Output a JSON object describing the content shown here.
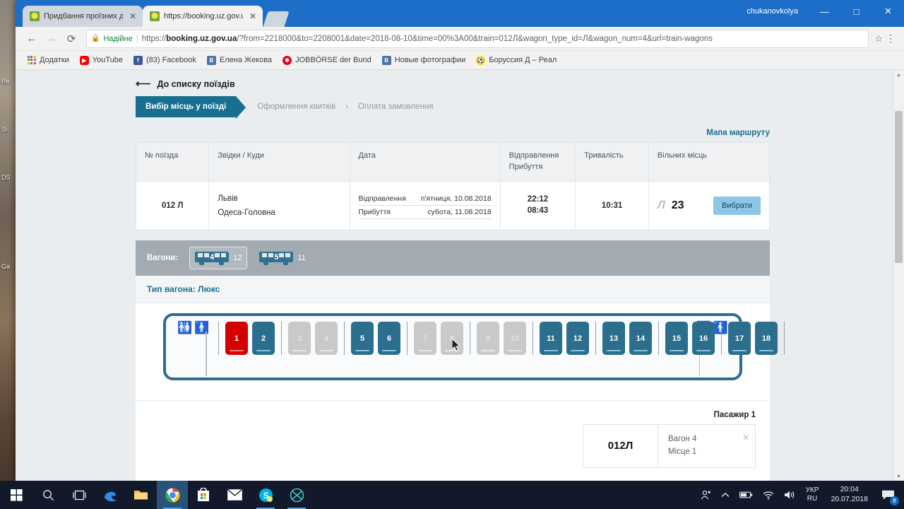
{
  "window": {
    "user": "chukanovkolya",
    "minimize": "—",
    "maximize": "□",
    "close": "✕"
  },
  "tabs": [
    {
      "title": "Придбання проїзних до",
      "close": "✕"
    },
    {
      "title": "https://booking.uz.gov.ua",
      "close": "✕"
    }
  ],
  "toolbar": {
    "back": "←",
    "forward": "→",
    "reload": "⟳",
    "secure_label": "Надійне",
    "url_prefix": "https://",
    "url_host": "booking.uz.gov.ua",
    "url_rest": "/?from=2218000&to=2208001&date=2018-08-10&time=00%3A00&train=012Л&wagon_type_id=Л&wagon_num=4&url=train-wagons",
    "star": "☆",
    "menu": "⋮"
  },
  "bookmarks": [
    {
      "label": "Додатки",
      "icon": "apps-grid-icon"
    },
    {
      "label": "YouTube",
      "icon": "youtube-icon"
    },
    {
      "label": "(83) Facebook",
      "icon": "facebook-icon"
    },
    {
      "label": "Елена Жекова",
      "icon": "vk-icon"
    },
    {
      "label": "JOBBÖRSE der Bund",
      "icon": "arbeitsagentur-icon"
    },
    {
      "label": "Новые фотографии",
      "icon": "vk-icon"
    },
    {
      "label": "Боруссия Д – Реал",
      "icon": "bvb-icon"
    }
  ],
  "page": {
    "back_link": "До списку поїздів",
    "back_arrow": "⟵",
    "steps": [
      {
        "label": "Вибір місць у поїзді",
        "state": "active"
      },
      {
        "label": "Оформлення квитків",
        "state": "pending"
      },
      {
        "label": "Оплата замовлення",
        "state": "pending"
      }
    ],
    "step_chevron": "›",
    "route_map_link": "Мапа маршруту"
  },
  "train_table": {
    "headers": {
      "number": "№ поїзда",
      "stations": "Звідки / Куди",
      "date": "Дата",
      "dep_arr": "Відправлення",
      "dep_arr2": "Прибуття",
      "duration": "Тривалість",
      "free": "Вільних місць"
    },
    "row": {
      "number": "012 Л",
      "station_from": "Львів",
      "station_to": "Одеса-Головна",
      "dep_label": "Відправлення",
      "dep_value": "п'ятниця, 10.08.2018",
      "arr_label": "Прибуття",
      "arr_value": "субота, 11.08.2018",
      "dep_time": "22:12",
      "arr_time": "08:43",
      "duration": "10:31",
      "class_letter": "Л",
      "free_count": "23",
      "select_button": "Вибрати"
    }
  },
  "wagons_bar": {
    "label": "Вагони:",
    "items": [
      {
        "num": "4",
        "free": "12",
        "selected": true
      },
      {
        "num": "5",
        "free": "11",
        "selected": false
      }
    ]
  },
  "wagon_type": "Тип вагона: Люкс",
  "seatmap": {
    "wc_left": "wc-icon",
    "wc_right": "wc-icon",
    "compartments": [
      [
        {
          "num": "1",
          "state": "selected"
        },
        {
          "num": "2",
          "state": "free"
        }
      ],
      [
        {
          "num": "3",
          "state": "taken"
        },
        {
          "num": "4",
          "state": "taken"
        }
      ],
      [
        {
          "num": "5",
          "state": "free"
        },
        {
          "num": "6",
          "state": "free"
        }
      ],
      [
        {
          "num": "7",
          "state": "taken"
        },
        {
          "num": "8",
          "state": "taken"
        }
      ],
      [
        {
          "num": "9",
          "state": "taken"
        },
        {
          "num": "10",
          "state": "taken"
        }
      ],
      [
        {
          "num": "11",
          "state": "free"
        },
        {
          "num": "12",
          "state": "free"
        }
      ],
      [
        {
          "num": "13",
          "state": "free"
        },
        {
          "num": "14",
          "state": "free"
        }
      ],
      [
        {
          "num": "15",
          "state": "free"
        },
        {
          "num": "16",
          "state": "free"
        }
      ],
      [
        {
          "num": "17",
          "state": "free"
        },
        {
          "num": "18",
          "state": "free"
        }
      ]
    ]
  },
  "passenger": {
    "title": "Пасажир 1",
    "train": "012Л",
    "wagon": "Вагон 4",
    "seat": "Місце 1",
    "remove": "✕"
  },
  "desktop_icons": [
    {
      "label": "Rе"
    },
    {
      "label": "Sі"
    },
    {
      "label": "DS"
    },
    {
      "label": ""
    },
    {
      "label": "Ga"
    }
  ],
  "taskbar": {
    "items": [
      {
        "name": "start-button",
        "glyph": "⊞"
      },
      {
        "name": "search-button",
        "glyph": "⌕"
      },
      {
        "name": "task-view-button",
        "glyph": "▭"
      },
      {
        "name": "edge-button",
        "glyph": "e"
      },
      {
        "name": "file-explorer-button",
        "glyph": "🗁"
      },
      {
        "name": "chrome-button",
        "glyph": "◉"
      },
      {
        "name": "store-button",
        "glyph": "🛍"
      },
      {
        "name": "mail-button",
        "glyph": "✉"
      },
      {
        "name": "skype-button",
        "glyph": "S"
      },
      {
        "name": "utorrent-button",
        "glyph": "⊗"
      }
    ],
    "tray": {
      "people": "⚹",
      "chevron": "∧",
      "battery": "▭",
      "wifi": "◡",
      "volume": "◁",
      "lang_top": "УКР",
      "lang_bottom": "RU",
      "time": "20:04",
      "date": "20.07.2018",
      "action_center": "☰",
      "badge": "8"
    }
  },
  "colors": {
    "accent": "#17708f",
    "seat_free": "#2c6e8e",
    "seat_selected": "#d40000",
    "seat_taken": "#c9c9c9",
    "titlebar": "#1d6ec9",
    "wagon_bar": "#a2abb2",
    "select_button": "#8cc7e6"
  }
}
